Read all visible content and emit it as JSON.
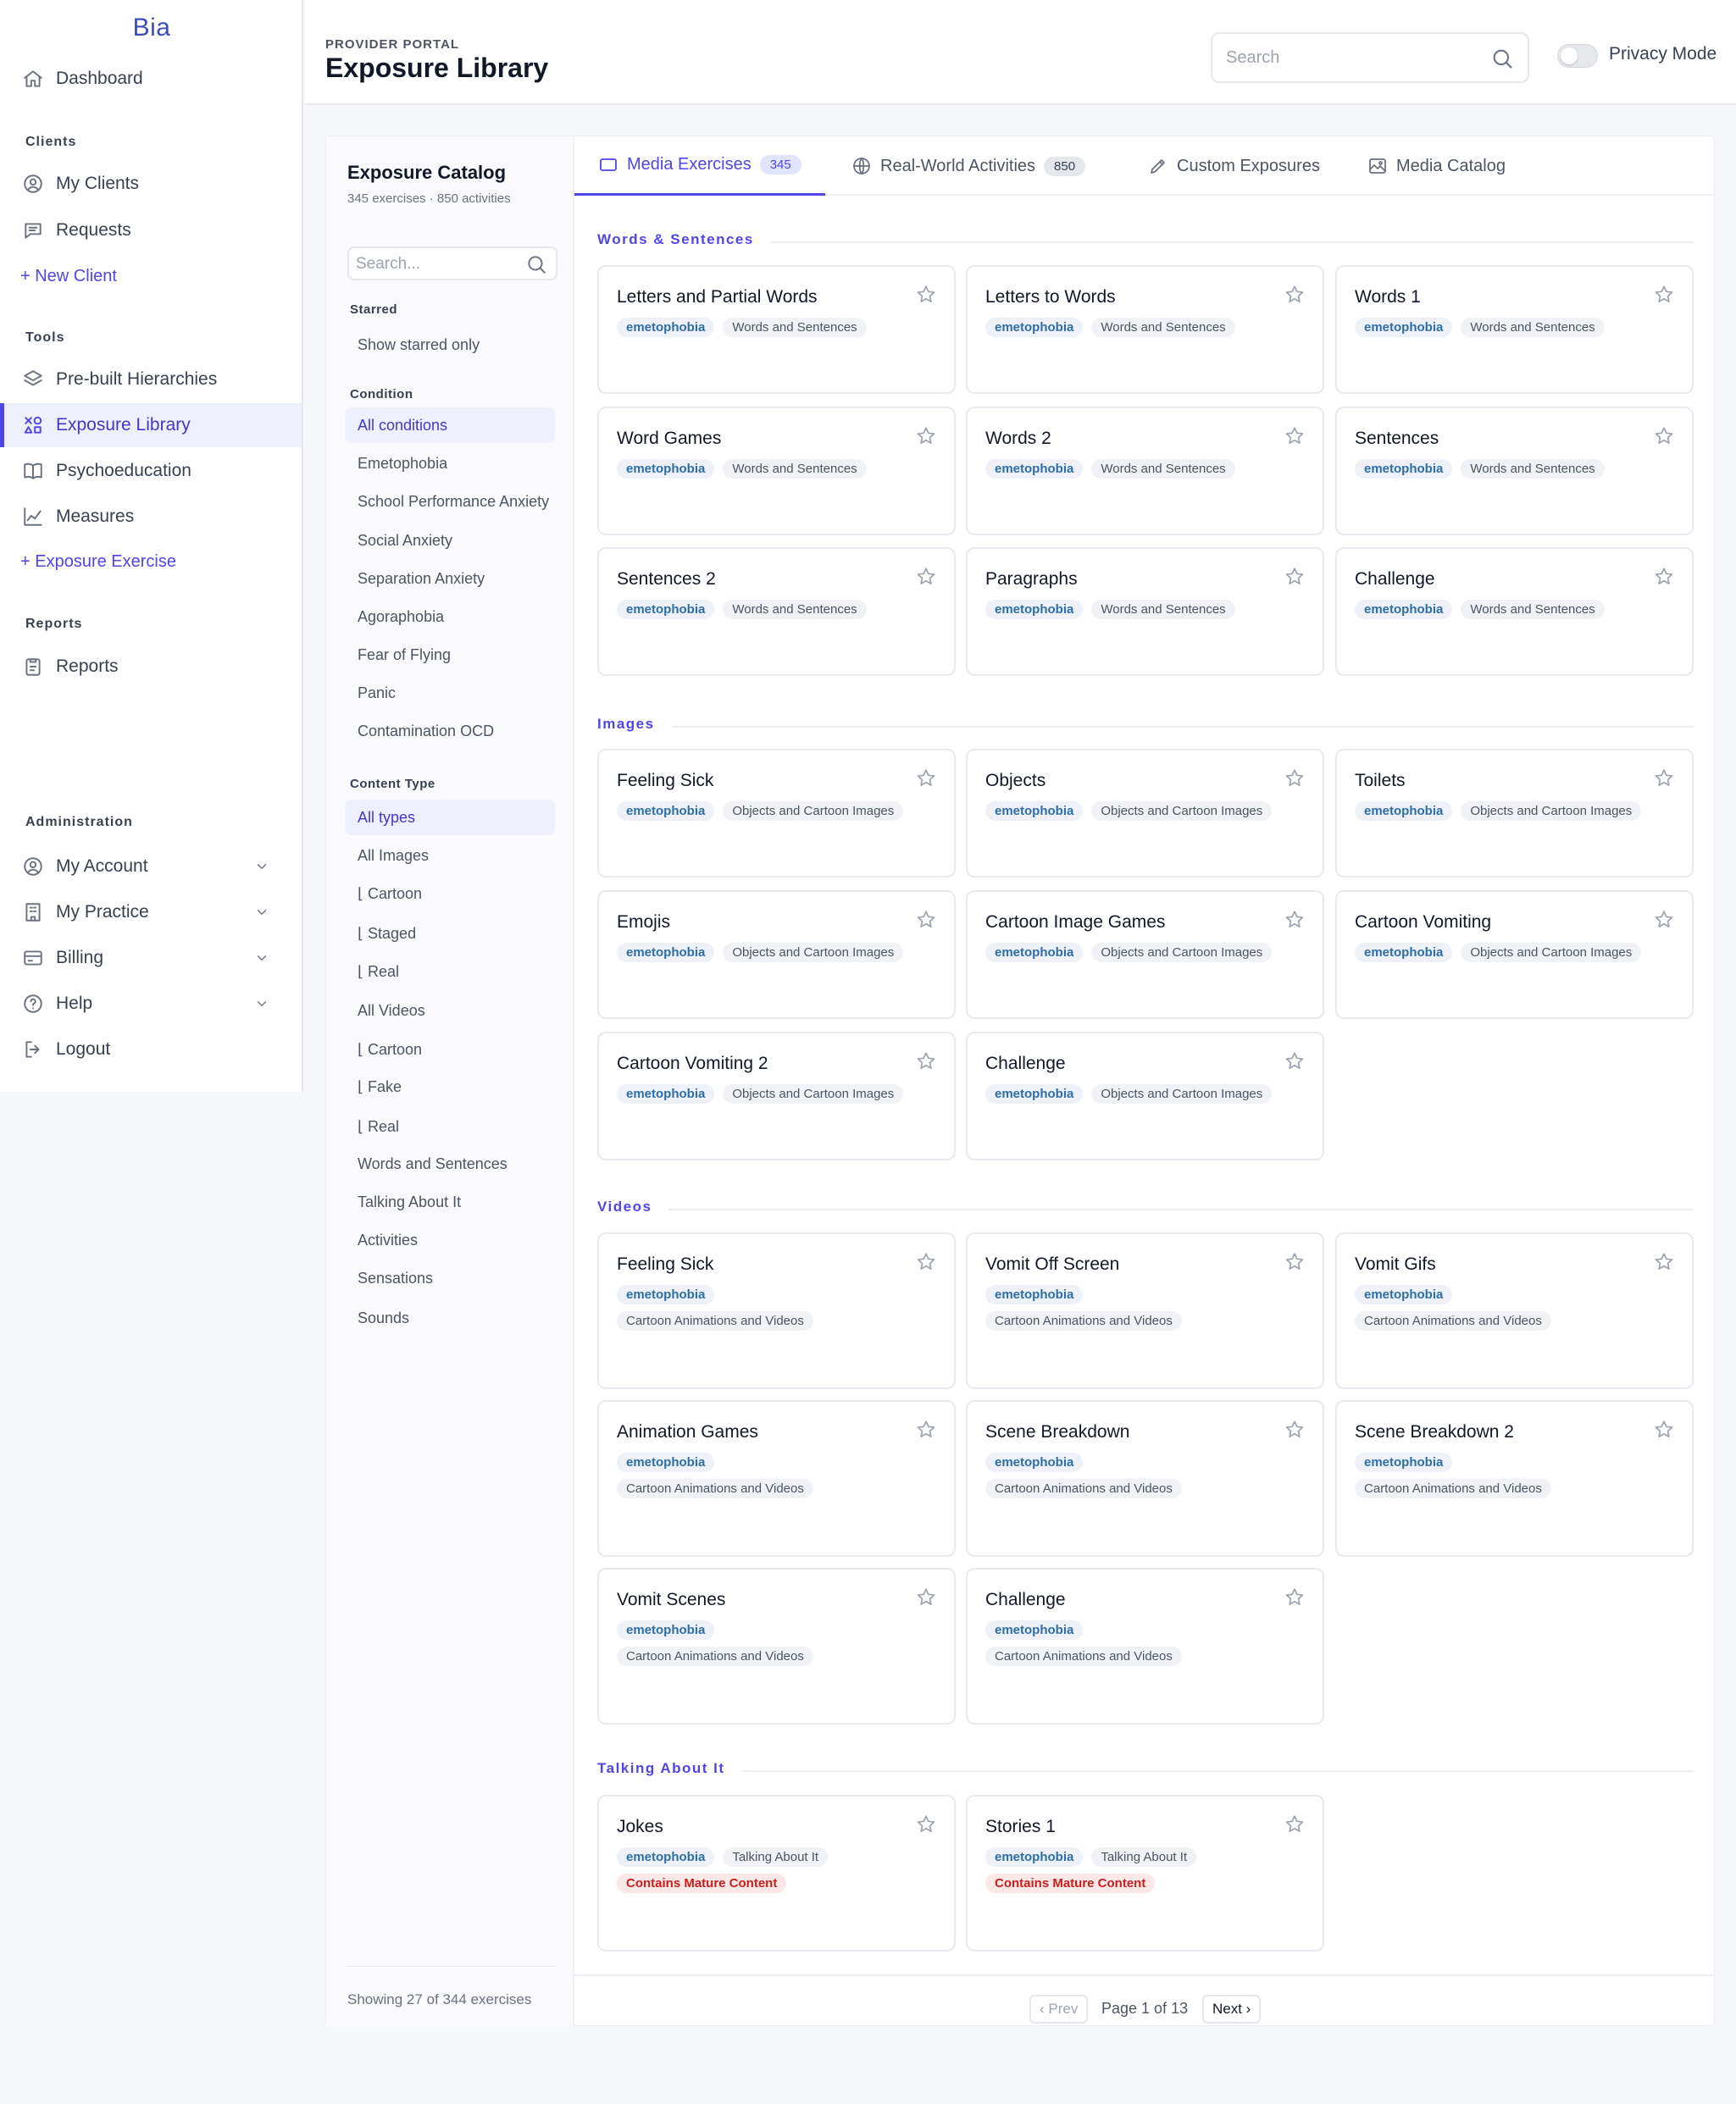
{
  "app": {
    "logo": "Bia"
  },
  "sidebar": {
    "dashboard": "Dashboard",
    "sections": {
      "clients": "Clients",
      "tools": "Tools",
      "reports": "Reports",
      "administration": "Administration"
    },
    "clients": [
      "My Clients",
      "Requests"
    ],
    "new_client": "+ New Client",
    "tools": [
      "Pre-built Hierarchies",
      "Exposure Library",
      "Psychoeducation",
      "Measures"
    ],
    "exposure_exercise": "+ Exposure Exercise",
    "reports": [
      "Reports"
    ],
    "admin": [
      "My Account",
      "My Practice",
      "Billing",
      "Help",
      "Logout"
    ]
  },
  "header": {
    "portal_label": "PROVIDER PORTAL",
    "title": "Exposure Library",
    "search_placeholder": "Search",
    "privacy_label": "Privacy Mode"
  },
  "filters": {
    "title": "Exposure Catalog",
    "subtitle": "345 exercises · 850 activities",
    "search_placeholder": "Search...",
    "starred_label": "Starred",
    "starred_option": "Show starred only",
    "condition_label": "Condition",
    "conditions": [
      "All conditions",
      "Emetophobia",
      "School Performance Anxiety",
      "Social Anxiety",
      "Separation Anxiety",
      "Agoraphobia",
      "Fear of Flying",
      "Panic",
      "Contamination OCD"
    ],
    "content_type_label": "Content Type",
    "content_types": [
      "All types",
      "All Images",
      "⌊ Cartoon",
      "⌊ Staged",
      "⌊ Real",
      "All Videos",
      "⌊ Cartoon",
      "⌊ Fake",
      "⌊ Real",
      "Words and Sentences",
      "Talking About It",
      "Activities",
      "Sensations",
      "Sounds"
    ],
    "showing": "Showing 27 of 344 exercises"
  },
  "tabs": [
    {
      "label": "Media Exercises",
      "badge": "345"
    },
    {
      "label": "Real-World Activities",
      "badge": "850"
    },
    {
      "label": "Custom Exposures"
    },
    {
      "label": "Media Catalog"
    }
  ],
  "groups": {
    "words": {
      "title": "Words & Sentences",
      "cards": [
        {
          "title": "Letters and Partial Words",
          "condition": "emetophobia",
          "type": "Words and Sentences"
        },
        {
          "title": "Letters to Words",
          "condition": "emetophobia",
          "type": "Words and Sentences"
        },
        {
          "title": "Words 1",
          "condition": "emetophobia",
          "type": "Words and Sentences"
        },
        {
          "title": "Word Games",
          "condition": "emetophobia",
          "type": "Words and Sentences"
        },
        {
          "title": "Words 2",
          "condition": "emetophobia",
          "type": "Words and Sentences"
        },
        {
          "title": "Sentences",
          "condition": "emetophobia",
          "type": "Words and Sentences"
        },
        {
          "title": "Sentences 2",
          "condition": "emetophobia",
          "type": "Words and Sentences"
        },
        {
          "title": "Paragraphs",
          "condition": "emetophobia",
          "type": "Words and Sentences"
        },
        {
          "title": "Challenge",
          "condition": "emetophobia",
          "type": "Words and Sentences"
        }
      ]
    },
    "images": {
      "title": "Images",
      "cards": [
        {
          "title": "Feeling Sick",
          "condition": "emetophobia",
          "type": "Objects and Cartoon Images"
        },
        {
          "title": "Objects",
          "condition": "emetophobia",
          "type": "Objects and Cartoon Images"
        },
        {
          "title": "Toilets",
          "condition": "emetophobia",
          "type": "Objects and Cartoon Images"
        },
        {
          "title": "Emojis",
          "condition": "emetophobia",
          "type": "Objects and Cartoon Images"
        },
        {
          "title": "Cartoon Image Games",
          "condition": "emetophobia",
          "type": "Objects and Cartoon Images"
        },
        {
          "title": "Cartoon Vomiting",
          "condition": "emetophobia",
          "type": "Objects and Cartoon Images"
        },
        {
          "title": "Cartoon Vomiting 2",
          "condition": "emetophobia",
          "type": "Objects and Cartoon Images"
        },
        {
          "title": "Challenge",
          "condition": "emetophobia",
          "type": "Objects and Cartoon Images"
        }
      ]
    },
    "videos": {
      "title": "Videos",
      "cards": [
        {
          "title": "Feeling Sick",
          "condition": "emetophobia",
          "type": "Cartoon Animations and Videos"
        },
        {
          "title": "Vomit Off Screen",
          "condition": "emetophobia",
          "type": "Cartoon Animations and Videos"
        },
        {
          "title": "Vomit Gifs",
          "condition": "emetophobia",
          "type": "Cartoon Animations and Videos"
        },
        {
          "title": "Animation Games",
          "condition": "emetophobia",
          "type": "Cartoon Animations and Videos"
        },
        {
          "title": "Scene Breakdown",
          "condition": "emetophobia",
          "type": "Cartoon Animations and Videos"
        },
        {
          "title": "Scene Breakdown 2",
          "condition": "emetophobia",
          "type": "Cartoon Animations and Videos"
        },
        {
          "title": "Vomit Scenes",
          "condition": "emetophobia",
          "type": "Cartoon Animations and Videos"
        },
        {
          "title": "Challenge",
          "condition": "emetophobia",
          "type": "Cartoon Animations and Videos"
        }
      ]
    },
    "talking": {
      "title": "Talking About It",
      "cards": [
        {
          "title": "Jokes",
          "condition": "emetophobia",
          "type": "Talking About It",
          "warning": "Contains Mature Content"
        },
        {
          "title": "Stories 1",
          "condition": "emetophobia",
          "type": "Talking About It",
          "warning": "Contains Mature Content"
        }
      ]
    }
  },
  "pagination": {
    "prev": "‹ Prev",
    "info": "Page 1 of 13",
    "next": "Next ›"
  },
  "colors": {
    "accent": "#4f46e5",
    "condition_tag": "#2e6ea8",
    "warning": "#c81e1e"
  }
}
